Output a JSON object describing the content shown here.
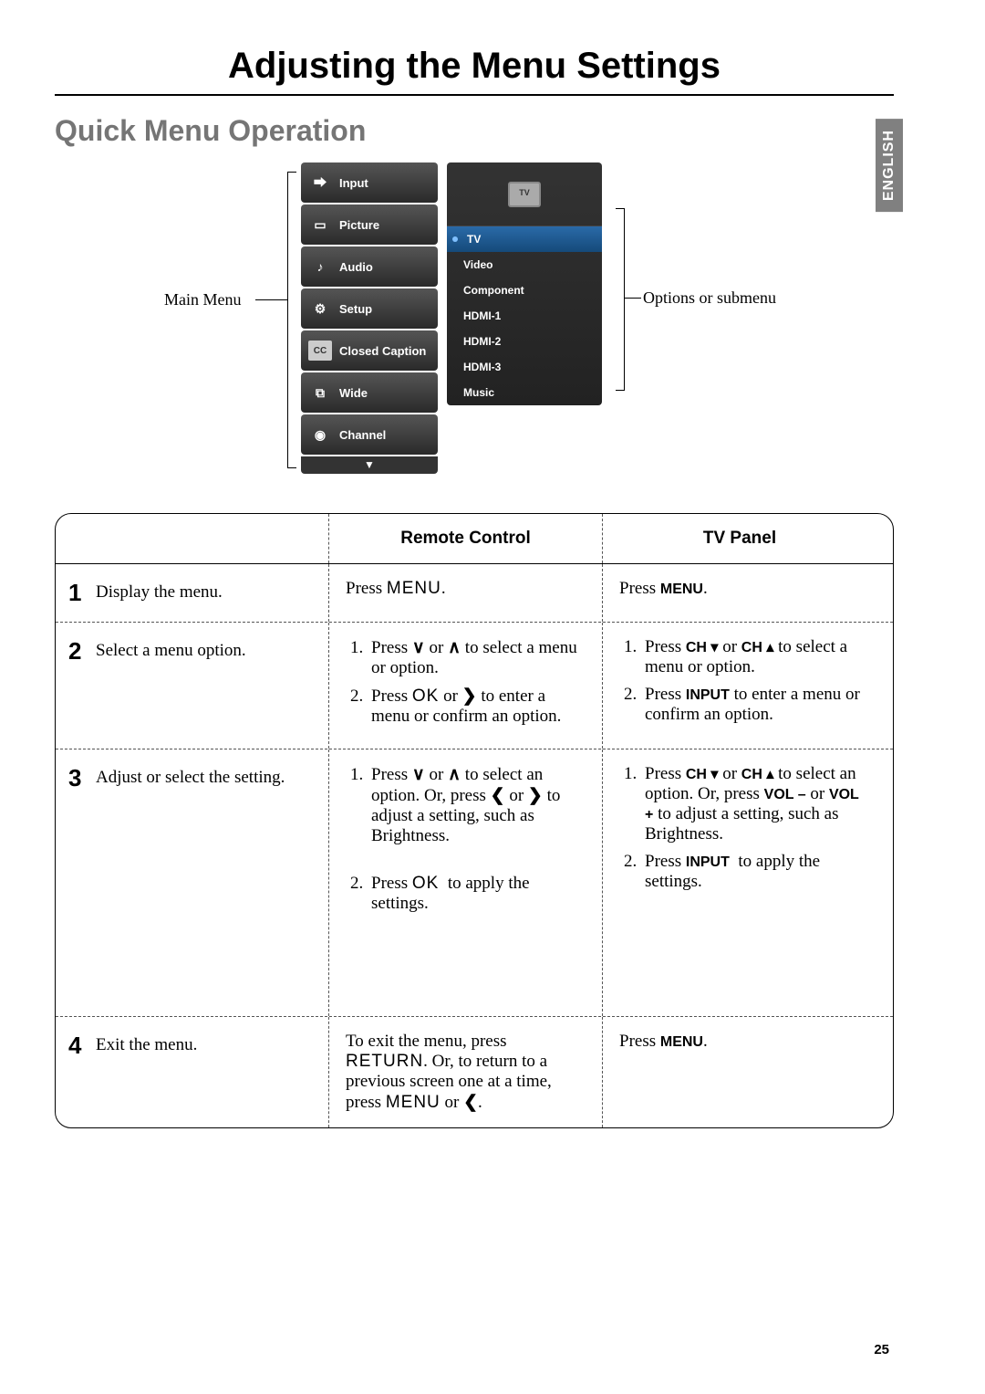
{
  "page": {
    "title": "Adjusting the Menu Settings",
    "section": "Quick Menu Operation",
    "language": "ENGLISH",
    "number": "25"
  },
  "diagram": {
    "main_label": "Main Menu",
    "options_label": "Options or submenu",
    "menu_items": [
      {
        "label": "Input",
        "icon": "input-icon"
      },
      {
        "label": "Picture",
        "icon": "picture-icon"
      },
      {
        "label": "Audio",
        "icon": "audio-icon"
      },
      {
        "label": "Setup",
        "icon": "setup-icon"
      },
      {
        "label": "Closed Caption",
        "icon": "cc-icon"
      },
      {
        "label": "Wide",
        "icon": "wide-icon"
      },
      {
        "label": "Channel",
        "icon": "channel-icon"
      }
    ],
    "submenu": {
      "header_icon": "tv-icon",
      "items": [
        {
          "label": "TV",
          "active": true
        },
        {
          "label": "Video"
        },
        {
          "label": "Component"
        },
        {
          "label": "HDMI-1"
        },
        {
          "label": "HDMI-2"
        },
        {
          "label": "HDMI-3"
        },
        {
          "label": "Music"
        }
      ]
    }
  },
  "table": {
    "headers": {
      "remote": "Remote Control",
      "panel": "TV Panel"
    },
    "rows": [
      {
        "num": "1",
        "action": "Display the menu.",
        "remote_html": "Press <span class='key'>MENU</span>.",
        "panel_html": "Press <span class='keybold'>MENU</span>."
      },
      {
        "num": "2",
        "action": "Select a menu option.",
        "remote_html": "<ol><li>Press <span class='arrow-glyph'>∨</span> or <span class='arrow-glyph'>∧</span> to select a menu or option.</li><li>Press <span class='key'>OK</span> or <span class='arrow-glyph'>❯</span> to enter a menu or confirm an option.</li></ol>",
        "panel_html": "<ol><li>Press <span class='keybold'>CH ▾</span> or <span class='keybold'>CH ▴</span> to select a menu or option.</li><li>Press <span class='keybold'>INPUT</span> to enter a menu or confirm an option.</li></ol>"
      },
      {
        "num": "3",
        "action": "Adjust or select the setting.",
        "remote_html": "<ol><li>Press <span class='arrow-glyph'>∨</span> or <span class='arrow-glyph'>∧</span> to select an option. Or, press <span class='arrow-glyph'>❮</span> or <span class='arrow-glyph'>❯</span> to adjust a setting, such as Brightness.<br><br></li><li>Press <span class='key'>OK</span>&nbsp; to apply the settings.<br><br><br><br><br></li></ol>",
        "panel_html": "<ol><li>Press <span class='keybold'>CH ▾</span> or <span class='keybold'>CH ▴</span> to select an option. Or, press <span class='keybold'>VOL –</span> or <span class='keybold'>VOL +</span> to adjust a setting, such as Brightness.</li><li>Press <span class='keybold'>INPUT</span>&nbsp; to apply the settings.</li></ol>"
      },
      {
        "num": "4",
        "action": "Exit the menu.",
        "remote_html": "To exit the menu, press <span class='key'>RETURN</span>. Or, to return to a previous screen one at a time, press <span class='key'>MENU</span> or <span class='arrow-glyph'>❮</span>.",
        "panel_html": "Press <span class='keybold'>MENU</span>."
      }
    ]
  }
}
